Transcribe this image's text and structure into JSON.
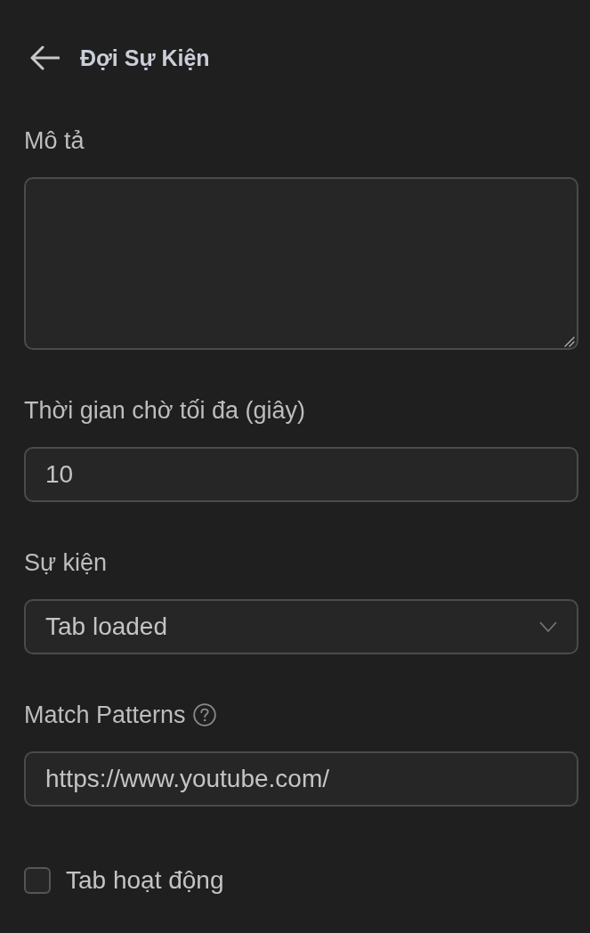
{
  "header": {
    "title": "Đợi Sự Kiện"
  },
  "fields": [
    {
      "kind": "textarea",
      "label": "Mô tả"
    },
    {
      "kind": "input",
      "label": "Thời gian chờ tối đa (giây)",
      "value": "10"
    },
    {
      "kind": "select",
      "label": "Sự kiện",
      "value": "Tab loaded"
    },
    {
      "kind": "input",
      "label": "Match Patterns",
      "value": "https://www.youtube.com/",
      "help": true
    }
  ],
  "checkbox": {
    "label": "Tab hoạt động",
    "checked": false
  }
}
